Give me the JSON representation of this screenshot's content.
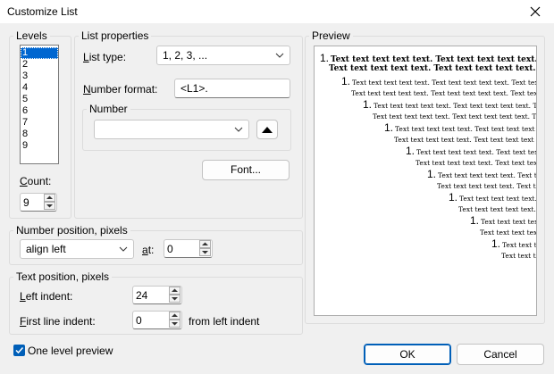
{
  "window": {
    "title": "Customize List"
  },
  "levels": {
    "legend": "Levels",
    "items": [
      "1",
      "2",
      "3",
      "4",
      "5",
      "6",
      "7",
      "8",
      "9"
    ],
    "selected_index": 0,
    "count_label": "Count:",
    "count_value": "9"
  },
  "list_properties": {
    "legend": "List properties",
    "list_type_label": "List type:",
    "list_type_value": "1, 2, 3, ...",
    "number_format_label": "Number format:",
    "number_format_value": "<L1>.",
    "number_group_legend": "Number",
    "number_combo_value": "",
    "font_button": "Font..."
  },
  "number_position": {
    "legend": "Number position, pixels",
    "alignment_value": "align left",
    "at_label": "at:",
    "at_value": "0"
  },
  "text_position": {
    "legend": "Text position, pixels",
    "left_indent_label": "Left indent:",
    "left_indent_value": "24",
    "first_line_label": "First line indent:",
    "first_line_value": "0",
    "first_line_suffix": "from left indent"
  },
  "preview": {
    "legend": "Preview",
    "lines": [
      "1. Text text text text text. Text text text text text. Te",
      "Text text text text text. Text text text text text. Te",
      "1. Text text text text text. Text text text text text. Text text te",
      "Text text text text text. Text text text text text. Text text te",
      "1. Text text text text text. Text text text text text. Te",
      "Text text text text text. Text text text text text. Te",
      "1. Text text text text text. Text text text text text. Te",
      "Text text text text text. Text text text text text. Te",
      "1. Text text text text text. Text text text text t",
      "Text text text text text. Text text text text t",
      "1. Text text text text text. Text text text te",
      "Text text text text text. Text text text te",
      "1. Text text text text text. Text text t",
      "Text text text text text. Text text t",
      "1. Text text text text text. Text te",
      "Text text text text text. Text te",
      "1. Text text text text text. Te",
      "Text text text text text. Te"
    ]
  },
  "one_level_preview": {
    "label": "One level preview",
    "checked": true
  },
  "buttons": {
    "ok": "OK",
    "cancel": "Cancel"
  },
  "colors": {
    "accent": "#005fb8",
    "selection": "#0066d0"
  },
  "icons": {
    "close": "close-icon",
    "dropdown": "chevron-down-icon",
    "spin_up": "spin-up-icon",
    "spin_down": "spin-down-icon",
    "triangle": "triangle-up-icon",
    "check": "check-icon"
  }
}
